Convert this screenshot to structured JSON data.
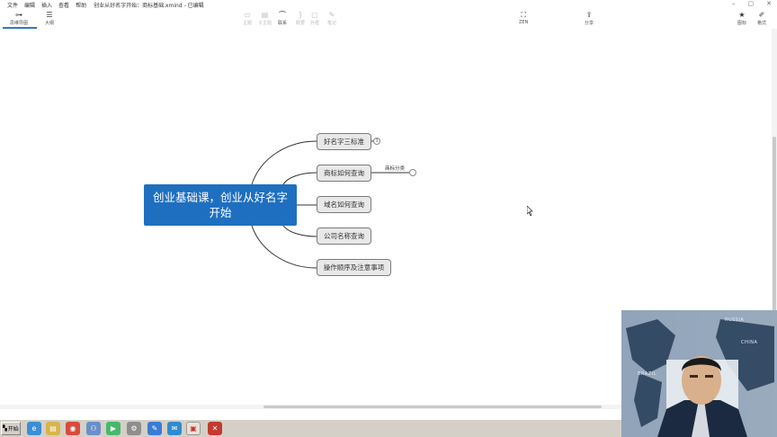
{
  "menu": [
    "文件",
    "编辑",
    "插入",
    "查看",
    "帮助"
  ],
  "window": {
    "title": "创业从好名字开始：商标基础.xmind - 已编辑"
  },
  "toolbar": {
    "mindmap": "思维导图",
    "outline": "大纲",
    "topic": "主题",
    "subtopic": "子主题",
    "relation": "联系",
    "summary": "概要",
    "boundary": "外框",
    "note": "笔记",
    "zen": "ZEN",
    "share": "分享",
    "icon": "图标",
    "format": "格式"
  },
  "mindmap": {
    "central": "创业基础课，创业从好名字开始",
    "topics": [
      "好名字三标准",
      "商标如何查询",
      "域名如何查询",
      "公司名称查询",
      "操作顺序及注意事项"
    ],
    "subtopic": "商标分类",
    "collapsed_count": "3"
  },
  "taskbar": {
    "start": "开始"
  },
  "webcam": {
    "labels": [
      "RUSSIA",
      "CHINA",
      "BRAZIL"
    ]
  },
  "colors": {
    "central": "#1f6fc0",
    "accent": "#2f77c9"
  },
  "icons": [
    "mindmap-icon",
    "outline-icon",
    "topic-icon",
    "subtopic-icon",
    "relation-icon",
    "summary-icon",
    "boundary-icon",
    "note-icon",
    "zen-icon",
    "share-icon",
    "star-icon",
    "brush-icon"
  ]
}
